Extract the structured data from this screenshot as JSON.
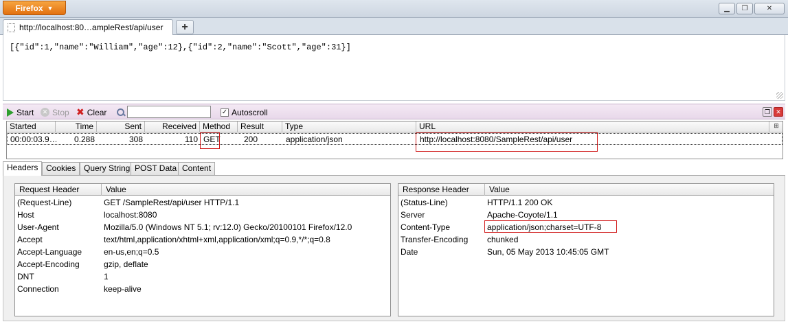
{
  "window": {
    "app_button_label": "Firefox",
    "minimize": "▁",
    "restore": "❐",
    "close": "✕"
  },
  "tabs": [
    {
      "title": "http://localhost:80…ampleRest/api/user"
    }
  ],
  "newtab_label": "+",
  "page_content": "[{\"id\":1,\"name\":\"William\",\"age\":12},{\"id\":2,\"name\":\"Scott\",\"age\":31}]",
  "httpfox": {
    "toolbar": {
      "start_label": "Start",
      "stop_label": "Stop",
      "clear_label": "Clear",
      "filter_value": "",
      "autoscroll_label": "Autoscroll",
      "autoscroll_checked": "✓"
    },
    "columns": [
      "Started",
      "Time",
      "Sent",
      "Received",
      "Method",
      "Result",
      "Type",
      "URL"
    ],
    "requests": [
      {
        "started": "00:00:03.9…",
        "time": "0.288",
        "sent": "308",
        "received": "110",
        "method": "GET",
        "result": "200",
        "type": "application/json",
        "url": "http://localhost:8080/SampleRest/api/user"
      }
    ],
    "detail_tabs": [
      "Headers",
      "Cookies",
      "Query String",
      "POST Data",
      "Content"
    ],
    "request_headers": {
      "col_name": "Request Header",
      "col_value": "Value",
      "rows": [
        {
          "k": "(Request-Line)",
          "v": "GET /SampleRest/api/user HTTP/1.1"
        },
        {
          "k": "Host",
          "v": "localhost:8080"
        },
        {
          "k": "User-Agent",
          "v": "Mozilla/5.0 (Windows NT 5.1; rv:12.0) Gecko/20100101 Firefox/12.0"
        },
        {
          "k": "Accept",
          "v": "text/html,application/xhtml+xml,application/xml;q=0.9,*/*;q=0.8"
        },
        {
          "k": "Accept-Language",
          "v": "en-us,en;q=0.5"
        },
        {
          "k": "Accept-Encoding",
          "v": "gzip, deflate"
        },
        {
          "k": "DNT",
          "v": "1"
        },
        {
          "k": "Connection",
          "v": "keep-alive"
        }
      ]
    },
    "response_headers": {
      "col_name": "Response Header",
      "col_value": "Value",
      "rows": [
        {
          "k": "(Status-Line)",
          "v": "HTTP/1.1 200 OK"
        },
        {
          "k": "Server",
          "v": "Apache-Coyote/1.1"
        },
        {
          "k": "Content-Type",
          "v": "application/json;charset=UTF-8"
        },
        {
          "k": "Transfer-Encoding",
          "v": "chunked"
        },
        {
          "k": "Date",
          "v": "Sun, 05 May 2013 10:45:05 GMT"
        }
      ]
    }
  },
  "colors": {
    "highlight": "#d11b1b",
    "firefox_orange": "#e2700f",
    "start_green": "#2f9e2f"
  }
}
